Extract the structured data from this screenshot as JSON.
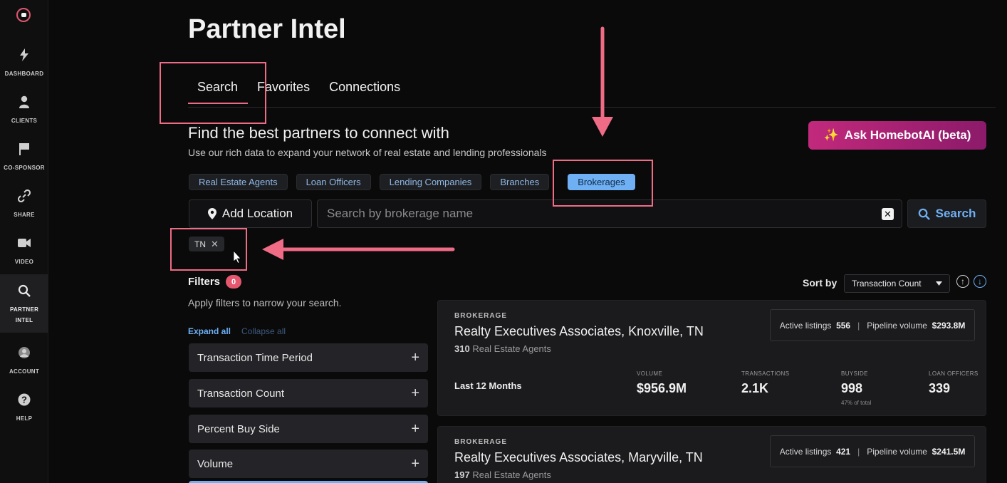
{
  "sidebar": {
    "items": [
      {
        "label": "DASHBOARD",
        "icon": "lightning-icon"
      },
      {
        "label": "CLIENTS",
        "icon": "person-icon"
      },
      {
        "label": "CO-SPONSOR",
        "icon": "flag-icon"
      },
      {
        "label": "SHARE",
        "icon": "link-icon"
      },
      {
        "label": "VIDEO",
        "icon": "video-camera-icon"
      },
      {
        "label": "PARTNER INTEL",
        "icon": "magnifier-icon",
        "active": true
      },
      {
        "label": "ACCOUNT",
        "icon": "avatar-icon"
      },
      {
        "label": "HELP",
        "icon": "question-icon"
      }
    ]
  },
  "header": {
    "title": "Partner Intel"
  },
  "tabs": [
    {
      "label": "Search",
      "active": true
    },
    {
      "label": "Favorites"
    },
    {
      "label": "Connections"
    }
  ],
  "intro": {
    "headline": "Find the best partners to connect with",
    "subline": "Use our rich data to expand your network of real estate and lending professionals"
  },
  "ai_button": {
    "label": "Ask HomebotAI (beta)",
    "icon": "sparkles-icon"
  },
  "category_chips": [
    {
      "label": "Real Estate Agents"
    },
    {
      "label": "Loan Officers"
    },
    {
      "label": "Lending Companies"
    },
    {
      "label": "Branches"
    },
    {
      "label": "Brokerages",
      "active": true
    }
  ],
  "location_button": {
    "label": "Add Location",
    "icon": "map-pin-icon"
  },
  "search": {
    "placeholder": "Search by brokerage name",
    "value": "",
    "button_label": "Search"
  },
  "location_tag": {
    "label": "TN"
  },
  "filters": {
    "label": "Filters",
    "count": "0",
    "hint": "Apply filters to narrow your search.",
    "expand_all": "Expand all",
    "collapse_all": "Collapse all",
    "facets": [
      "Transaction Time Period",
      "Transaction Count",
      "Percent Buy Side",
      "Volume"
    ]
  },
  "sort": {
    "label": "Sort by",
    "selected": "Transaction Count"
  },
  "results": [
    {
      "kind": "BROKERAGE",
      "name": "Realty Executives Associates, Knoxville, TN",
      "agents_count": "310",
      "agents_label": "Real Estate Agents",
      "active_listings_label": "Active listings",
      "active_listings": "556",
      "pipeline_label": "Pipeline volume",
      "pipeline": "$293.8M",
      "period": "Last 12 Months",
      "volume_label": "VOLUME",
      "volume": "$956.9M",
      "transactions_label": "TRANSACTIONS",
      "transactions": "2.1K",
      "buyside_label": "BUYSIDE",
      "buyside": "998",
      "buyside_note": "47% of total",
      "loan_officers_label": "LOAN OFFICERS",
      "loan_officers": "339"
    },
    {
      "kind": "BROKERAGE",
      "name": "Realty Executives Associates, Maryville, TN",
      "agents_count": "197",
      "agents_label": "Real Estate Agents",
      "active_listings_label": "Active listings",
      "active_listings": "421",
      "pipeline_label": "Pipeline volume",
      "pipeline": "$241.5M"
    }
  ],
  "colors": {
    "accent_pink": "#ec6a85",
    "accent_blue": "#6fb0f5",
    "ai_gradient_start": "#c2297c",
    "ai_gradient_end": "#8c1a6a",
    "background": "#0a0a0b"
  }
}
